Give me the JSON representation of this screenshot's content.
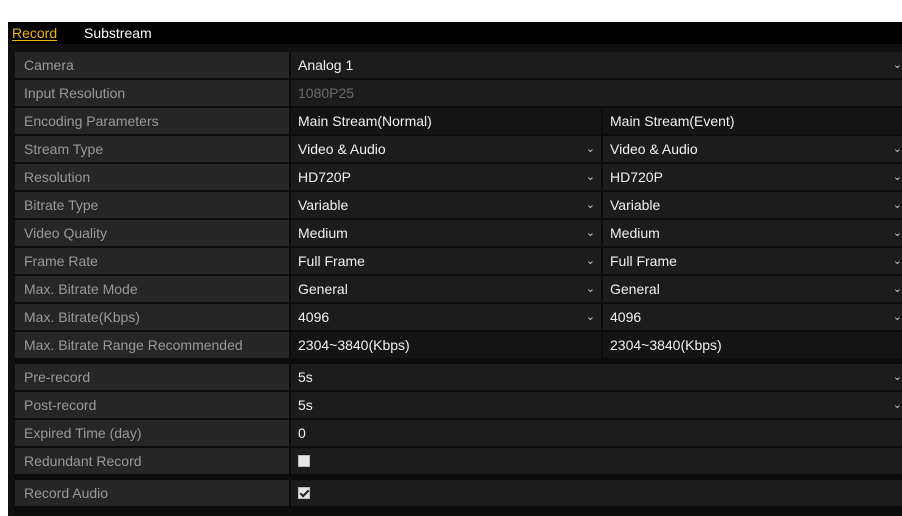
{
  "tabs": [
    {
      "label": "Record",
      "active": true
    },
    {
      "label": "Substream",
      "active": false
    }
  ],
  "colors": {
    "accent": "#f0b400",
    "label_bg": "#262626",
    "value_bg": "#1c1c1c"
  },
  "rows": {
    "camera": {
      "label": "Camera",
      "value": "Analog 1"
    },
    "input_resolution": {
      "label": "Input Resolution",
      "value": "1080P25"
    },
    "encoding_parameters": {
      "label": "Encoding Parameters",
      "main_normal": "Main Stream(Normal)",
      "main_event": "Main Stream(Event)"
    },
    "stream_type": {
      "label": "Stream Type",
      "main_normal": "Video & Audio",
      "main_event": "Video & Audio"
    },
    "resolution": {
      "label": "Resolution",
      "main_normal": "HD720P",
      "main_event": "HD720P"
    },
    "bitrate_type": {
      "label": "Bitrate Type",
      "main_normal": "Variable",
      "main_event": "Variable"
    },
    "video_quality": {
      "label": "Video Quality",
      "main_normal": "Medium",
      "main_event": "Medium"
    },
    "frame_rate": {
      "label": "Frame Rate",
      "main_normal": "Full Frame",
      "main_event": "Full Frame"
    },
    "max_bitrate_mode": {
      "label": "Max. Bitrate Mode",
      "main_normal": "General",
      "main_event": "General"
    },
    "max_bitrate": {
      "label": "Max. Bitrate(Kbps)",
      "main_normal": "4096",
      "main_event": "4096"
    },
    "max_bitrate_range": {
      "label": "Max. Bitrate Range Recommended",
      "main_normal": "2304~3840(Kbps)",
      "main_event": "2304~3840(Kbps)"
    },
    "pre_record": {
      "label": "Pre-record",
      "value": "5s"
    },
    "post_record": {
      "label": "Post-record",
      "value": "5s"
    },
    "expired_time": {
      "label": "Expired Time (day)",
      "value": "0"
    },
    "redundant_record": {
      "label": "Redundant Record",
      "checked": false
    },
    "record_audio": {
      "label": "Record Audio",
      "checked": true
    }
  },
  "icons": {
    "dropdown": "chevron-down-icon",
    "checkbox": "checkbox-icon"
  }
}
